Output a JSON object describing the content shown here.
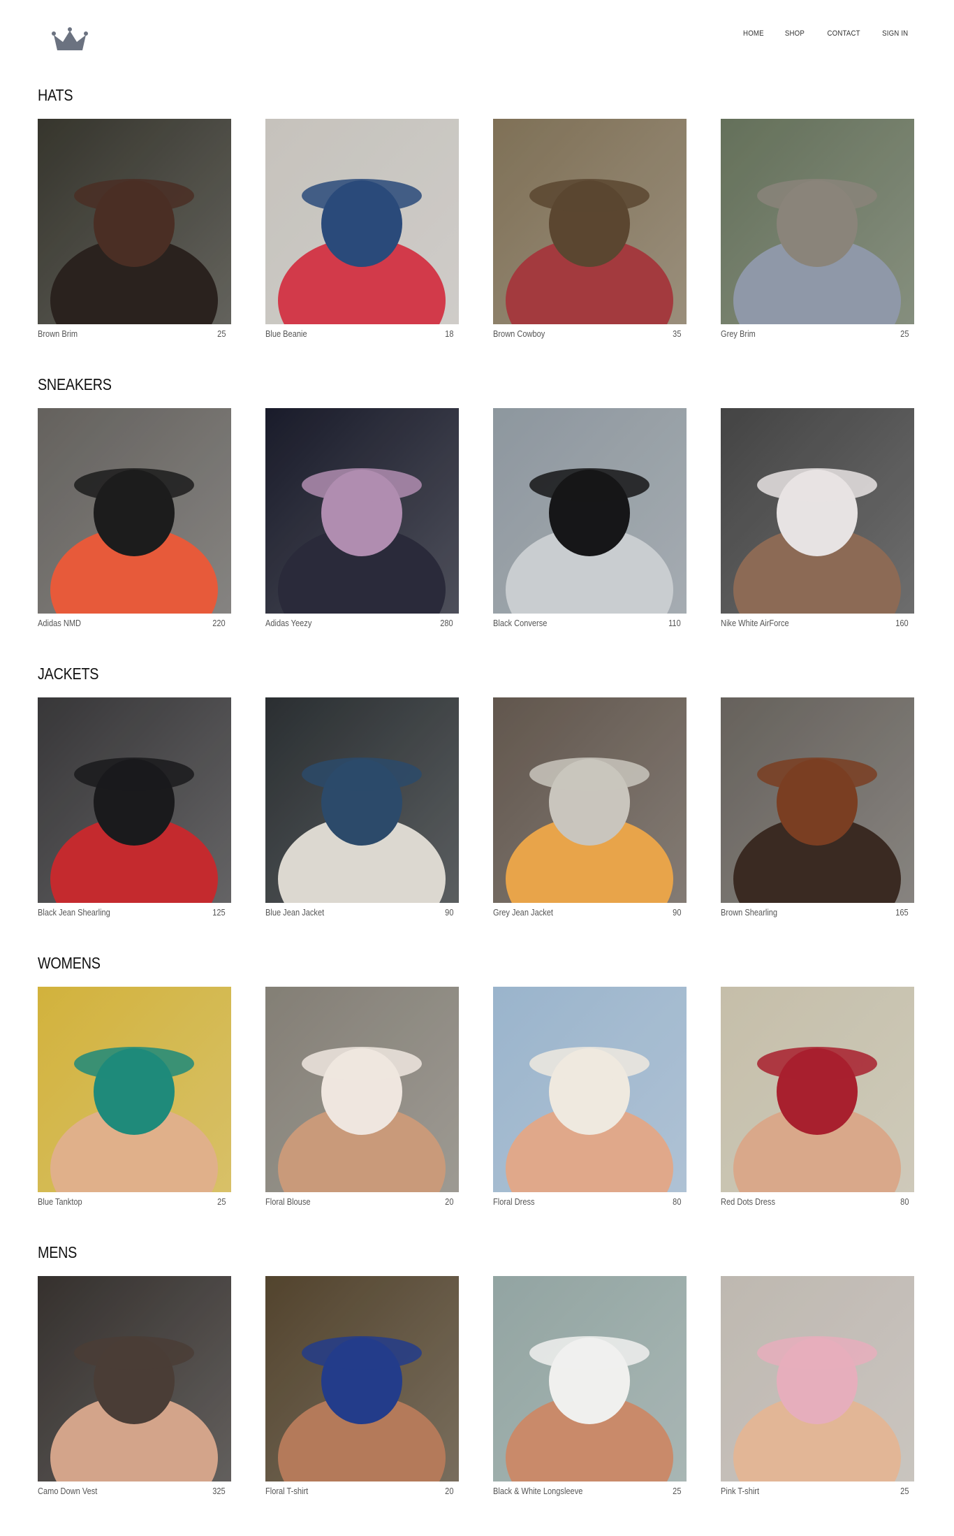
{
  "nav": {
    "items": [
      {
        "label": "HOME"
      },
      {
        "label": "SHOP"
      },
      {
        "label": "CONTACT"
      },
      {
        "label": "SIGN IN"
      }
    ]
  },
  "icons": {
    "logo": "crown-icon"
  },
  "colors": {
    "background": "#ffffff",
    "text": "#222222",
    "muted": "#555555",
    "logo": "#6b7280"
  },
  "sections": [
    {
      "title": "HATS",
      "items": [
        {
          "name": "Brown Brim",
          "price": "25",
          "bg": "#3b3a31",
          "accent": "#4a2e24",
          "skin": "#2a221e"
        },
        {
          "name": "Blue Beanie",
          "price": "18",
          "bg": "#d7d3cd",
          "accent": "#2a4a7a",
          "skin": "#d23a4a"
        },
        {
          "name": "Brown Cowboy",
          "price": "35",
          "bg": "#8a7a5e",
          "accent": "#5b4630",
          "skin": "#a33a3e"
        },
        {
          "name": "Grey Brim",
          "price": "25",
          "bg": "#6d7a62",
          "accent": "#8a847a",
          "skin": "#8f98a8"
        }
      ]
    },
    {
      "title": "SNEAKERS",
      "items": [
        {
          "name": "Adidas NMD",
          "price": "220",
          "bg": "#6d6a66",
          "accent": "#1c1c1c",
          "skin": "#e75a3a"
        },
        {
          "name": "Adidas Yeezy",
          "price": "280",
          "bg": "#1c1e2e",
          "accent": "#b08db0",
          "skin": "#2a2a3a"
        },
        {
          "name": "Black Converse",
          "price": "110",
          "bg": "#9aa4ac",
          "accent": "#161618",
          "skin": "#c9cdd0"
        },
        {
          "name": "Nike White AirForce",
          "price": "160",
          "bg": "#4a4a4a",
          "accent": "#e7e3e3",
          "skin": "#8c6a55"
        }
      ]
    },
    {
      "title": "JACKETS",
      "items": [
        {
          "name": "Black Jean Shearling",
          "price": "125",
          "bg": "#3d3c3e",
          "accent": "#1a1a1c",
          "skin": "#c42a2e"
        },
        {
          "name": "Blue Jean Jacket",
          "price": "90",
          "bg": "#2e3336",
          "accent": "#2c4a6a",
          "skin": "#dcd8d0"
        },
        {
          "name": "Grey Jean Jacket",
          "price": "90",
          "bg": "#6a5e54",
          "accent": "#c9c5bd",
          "skin": "#e8a44a"
        },
        {
          "name": "Brown Shearling",
          "price": "165",
          "bg": "#6f6a64",
          "accent": "#7a3e22",
          "skin": "#3a2a22"
        }
      ]
    },
    {
      "title": "WOMENS",
      "items": [
        {
          "name": "Blue Tanktop",
          "price": "25",
          "bg": "#e4c242",
          "accent": "#1f8a7a",
          "skin": "#e0b08a"
        },
        {
          "name": "Floral Blouse",
          "price": "20",
          "bg": "#8f8a80",
          "accent": "#efe6df",
          "skin": "#c99a7a"
        },
        {
          "name": "Floral Dress",
          "price": "80",
          "bg": "#a8c4de",
          "accent": "#efe9df",
          "skin": "#e0a88a"
        },
        {
          "name": "Red Dots Dress",
          "price": "80",
          "bg": "#d6cfb8",
          "accent": "#a8202e",
          "skin": "#d9a88a"
        }
      ]
    },
    {
      "title": "MENS",
      "items": [
        {
          "name": "Camo Down Vest",
          "price": "325",
          "bg": "#3a3532",
          "accent": "#4a3d36",
          "skin": "#d3a48a"
        },
        {
          "name": "Floral T-shirt",
          "price": "20",
          "bg": "#5a4a32",
          "accent": "#233c8a",
          "skin": "#b47a5a"
        },
        {
          "name": "Black & White Longsleeve",
          "price": "25",
          "bg": "#9fb3b0",
          "accent": "#f0f0ee",
          "skin": "#c98a6a"
        },
        {
          "name": "Pink T-shirt",
          "price": "25",
          "bg": "#cfc8c0",
          "accent": "#e6aebc",
          "skin": "#e2b696"
        }
      ]
    }
  ]
}
